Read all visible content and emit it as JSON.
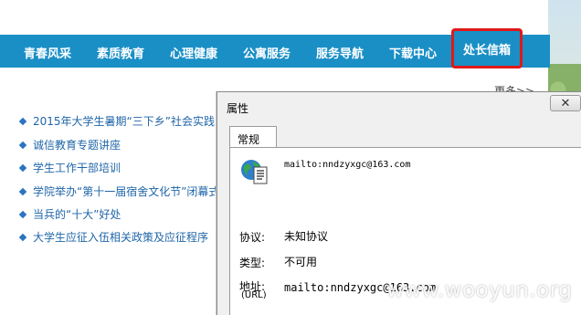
{
  "nav": {
    "items": [
      "青春风采",
      "素质教育",
      "心理健康",
      "公寓服务",
      "服务导航",
      "下载中心",
      "处长信箱"
    ]
  },
  "more_link": "更多>>",
  "news": [
    "2015年大学生暑期“三下乡”社会实践",
    "诚信教育专题讲座",
    "学生工作干部培训",
    "学院举办“第十一届宿舍文化节”闭幕式",
    "当兵的“十大”好处",
    "大学生应征入伍相关政策及应征程序"
  ],
  "dialog": {
    "title": "属性",
    "close_symbol": "✕",
    "tab": "常规",
    "url": "mailto:nndzyxgc@163.com",
    "protocol_label": "协议:",
    "protocol_value": "未知协议",
    "type_label": "类型:",
    "type_value": "不可用",
    "address_label": "地址:",
    "address_sub": "(URL)",
    "address_value": "mailto:nndzyxgc@163.com"
  },
  "watermark": "www.wooyun.org",
  "colors": {
    "nav_bg": "#1a8fc6",
    "highlight": "#e01818",
    "link": "#2066a8"
  }
}
